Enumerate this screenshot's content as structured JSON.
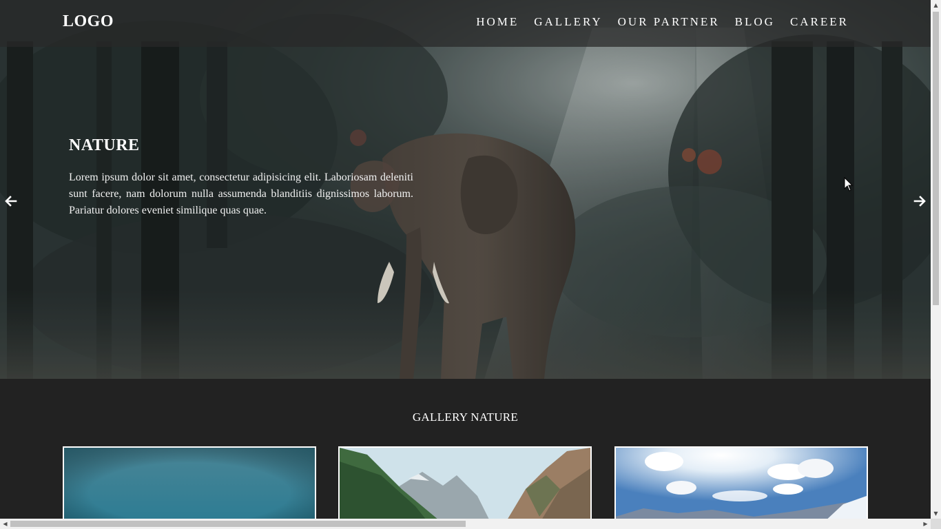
{
  "navbar": {
    "logo": "LOGO",
    "links": [
      "HOME",
      "GALLERY",
      "OUR PARTNER",
      "BLOG",
      "CAREER"
    ]
  },
  "hero": {
    "title": "NATURE",
    "text": "Lorem ipsum dolor sit amet, consectetur adipisicing elit. Laboriosam deleniti sunt facere, nam dolorum nulla assumenda blanditiis dignissimos laborum. Pariatur dolores eveniet similique quas quae.",
    "prev_icon": "arrow-left-icon",
    "next_icon": "arrow-right-icon"
  },
  "gallery": {
    "title": "GALLERY NATURE",
    "cards": [
      {
        "image": "lake-sky-image"
      },
      {
        "image": "mountain-valley-image"
      },
      {
        "image": "snowy-mountain-clouds-image"
      }
    ]
  },
  "colors": {
    "background": "#222222",
    "navbar": "#2f2f2f",
    "text": "#ffffff",
    "scrollbar_track": "#f1f1f1",
    "scrollbar_thumb": "#c1c1c1"
  }
}
